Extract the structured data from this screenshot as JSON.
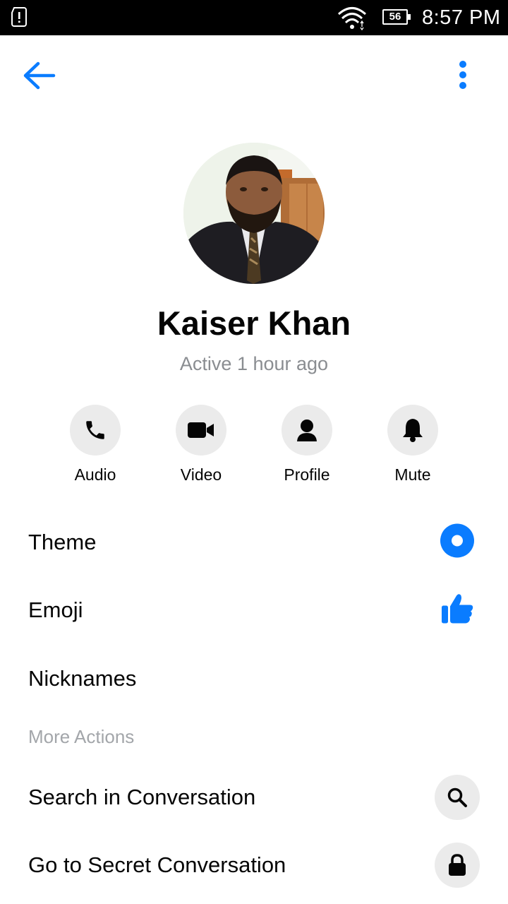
{
  "status_bar": {
    "battery": "56",
    "time": "8:57 PM"
  },
  "header": {
    "back_icon": "arrow-left-icon",
    "menu_icon": "more-vertical-icon",
    "accent": "#0a7cff"
  },
  "contact": {
    "name": "Kaiser Khan",
    "status": "Active 1 hour ago"
  },
  "quick_actions": [
    {
      "label": "Audio",
      "icon": "phone-icon"
    },
    {
      "label": "Video",
      "icon": "video-camera-icon"
    },
    {
      "label": "Profile",
      "icon": "person-icon"
    },
    {
      "label": "Mute",
      "icon": "bell-icon"
    }
  ],
  "settings": [
    {
      "label": "Theme",
      "icon": "theme-dot-icon"
    },
    {
      "label": "Emoji",
      "icon": "thumbs-up-icon"
    },
    {
      "label": "Nicknames"
    }
  ],
  "more_actions": {
    "header": "More Actions",
    "items": [
      {
        "label": "Search in Conversation",
        "icon": "search-icon"
      },
      {
        "label": "Go to Secret Conversation",
        "icon": "lock-icon"
      }
    ]
  }
}
